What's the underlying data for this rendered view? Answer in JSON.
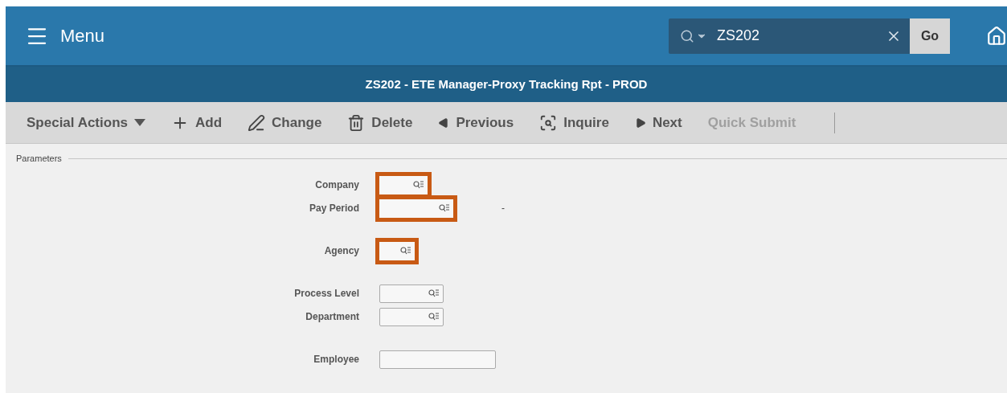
{
  "header": {
    "menu_label": "Menu",
    "search": {
      "value": "ZS202",
      "button": "Go"
    }
  },
  "title_bar": {
    "title": "ZS202 - ETE Manager-Proxy Tracking Rpt - PROD"
  },
  "toolbar": [
    {
      "kind": "dropdown",
      "label": "Special Actions",
      "disabled": false
    },
    {
      "kind": "add",
      "label": "Add",
      "disabled": false
    },
    {
      "kind": "change",
      "label": "Change",
      "disabled": false
    },
    {
      "kind": "delete",
      "label": "Delete",
      "disabled": false
    },
    {
      "kind": "previous",
      "label": "Previous",
      "disabled": false
    },
    {
      "kind": "inquire",
      "label": "Inquire",
      "disabled": false
    },
    {
      "kind": "next",
      "label": "Next",
      "disabled": false
    },
    {
      "kind": "plain",
      "label": "Quick Submit",
      "disabled": true
    }
  ],
  "section": {
    "title": "Parameters",
    "groups": [
      [
        {
          "label": "Company",
          "kind": "lookup",
          "highlighted": true
        },
        {
          "label": "Pay Period",
          "kind": "lookup",
          "highlighted": true,
          "suffix": "-"
        }
      ],
      [
        {
          "label": "Agency",
          "kind": "lookup",
          "highlighted": true
        }
      ],
      [
        {
          "label": "Process Level",
          "kind": "lookup",
          "highlighted": false
        },
        {
          "label": "Department",
          "kind": "lookup",
          "highlighted": false
        }
      ],
      [
        {
          "label": "Employee",
          "kind": "text",
          "highlighted": false
        }
      ]
    ]
  }
}
